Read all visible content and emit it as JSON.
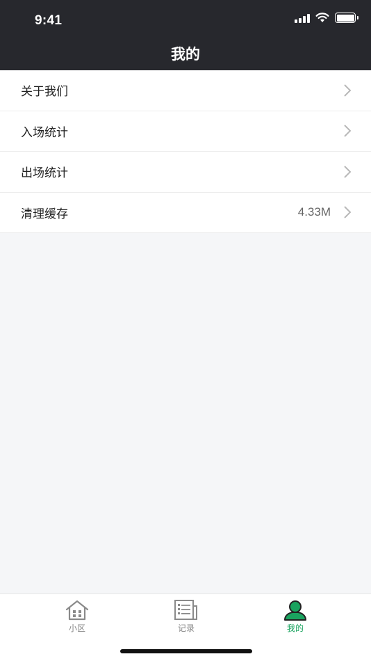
{
  "status_bar": {
    "time": "9:41"
  },
  "header": {
    "title": "我的"
  },
  "menu": {
    "items": [
      {
        "label": "关于我们",
        "value": ""
      },
      {
        "label": "入场统计",
        "value": ""
      },
      {
        "label": "出场统计",
        "value": ""
      },
      {
        "label": "清理缓存",
        "value": "4.33M"
      }
    ]
  },
  "tabbar": {
    "tabs": [
      {
        "label": "小区",
        "icon": "house-icon",
        "active": false
      },
      {
        "label": "记录",
        "icon": "document-list-icon",
        "active": false
      },
      {
        "label": "我的",
        "icon": "user-icon",
        "active": true
      }
    ]
  },
  "colors": {
    "header_bg": "#27282d",
    "page_bg": "#f5f6f8",
    "active_tab": "#1aa35f",
    "inactive_tab": "#888888"
  }
}
